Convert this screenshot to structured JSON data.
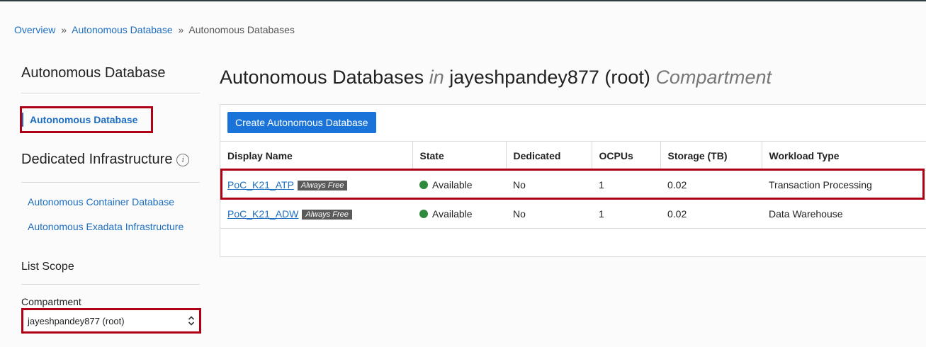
{
  "breadcrumb": {
    "items": [
      "Overview",
      "Autonomous Database"
    ],
    "separator": "»",
    "current": "Autonomous Databases"
  },
  "sidebar": {
    "heading": "Autonomous Database",
    "active_item": "Autonomous Database",
    "dedicated_heading": "Dedicated Infrastructure",
    "info_glyph": "i",
    "links": [
      "Autonomous Container Database",
      "Autonomous Exadata Infrastructure"
    ],
    "scope_heading": "List Scope",
    "compartment_label": "Compartment",
    "compartment_value": "jayeshpandey877 (root)"
  },
  "main": {
    "title": "Autonomous Databases",
    "title_in": "in",
    "title_compartment": "jayeshpandey877 (root)",
    "title_suffix": "Compartment",
    "create_button": "Create Autonomous Database",
    "columns": [
      "Display Name",
      "State",
      "Dedicated",
      "OCPUs",
      "Storage (TB)",
      "Workload Type"
    ],
    "rows": [
      {
        "name": "PoC_K21_ATP",
        "badge": "Always Free",
        "state": "Available",
        "dedicated": "No",
        "ocpus": "1",
        "storage": "0.02",
        "workload": "Transaction Processing"
      },
      {
        "name": "PoC_K21_ADW",
        "badge": "Always Free",
        "state": "Available",
        "dedicated": "No",
        "ocpus": "1",
        "storage": "0.02",
        "workload": "Data Warehouse"
      }
    ]
  },
  "colors": {
    "link": "#1b6ec2",
    "primary_button": "#1a73d9",
    "status_available": "#2f8a3d",
    "highlight_box": "#b00016"
  }
}
